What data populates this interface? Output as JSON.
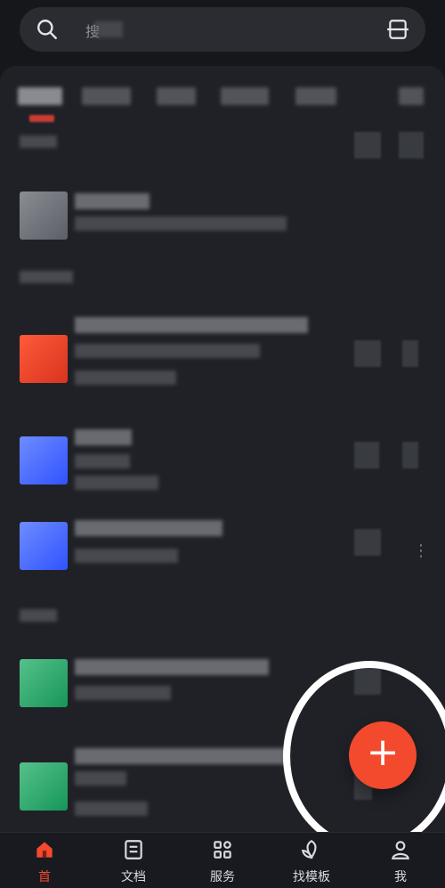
{
  "search": {
    "placeholder": "搜"
  },
  "bottom_nav": {
    "items": [
      {
        "label": "首",
        "icon": "home-icon",
        "active": true
      },
      {
        "label": "文档",
        "icon": "documents-icon",
        "active": false
      },
      {
        "label": "服务",
        "icon": "services-icon",
        "active": false
      },
      {
        "label": "找模板",
        "icon": "templates-icon",
        "active": false
      },
      {
        "label": "我",
        "icon": "profile-icon",
        "active": false
      }
    ]
  },
  "fab": {
    "label": "+"
  },
  "colors": {
    "accent": "#f34a2e",
    "background": "#16171b",
    "panel": "#202127"
  }
}
